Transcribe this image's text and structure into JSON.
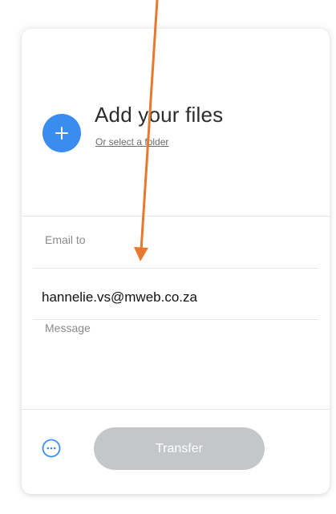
{
  "colors": {
    "accent": "#3b8cf0",
    "transfer_disabled": "#c4c6c8",
    "annotation_arrow": "#e8782f"
  },
  "upload": {
    "add_icon": "plus-icon",
    "title": "Add your files",
    "folder_link": "Or select a folder"
  },
  "form": {
    "email_label": "Email to",
    "email_value": "hannelie.vs@mweb.co.za",
    "message_label": "Message"
  },
  "footer": {
    "more_icon": "more-options-icon",
    "transfer_label": "Transfer"
  },
  "annotation": {
    "icon": "arrow-down-icon"
  }
}
